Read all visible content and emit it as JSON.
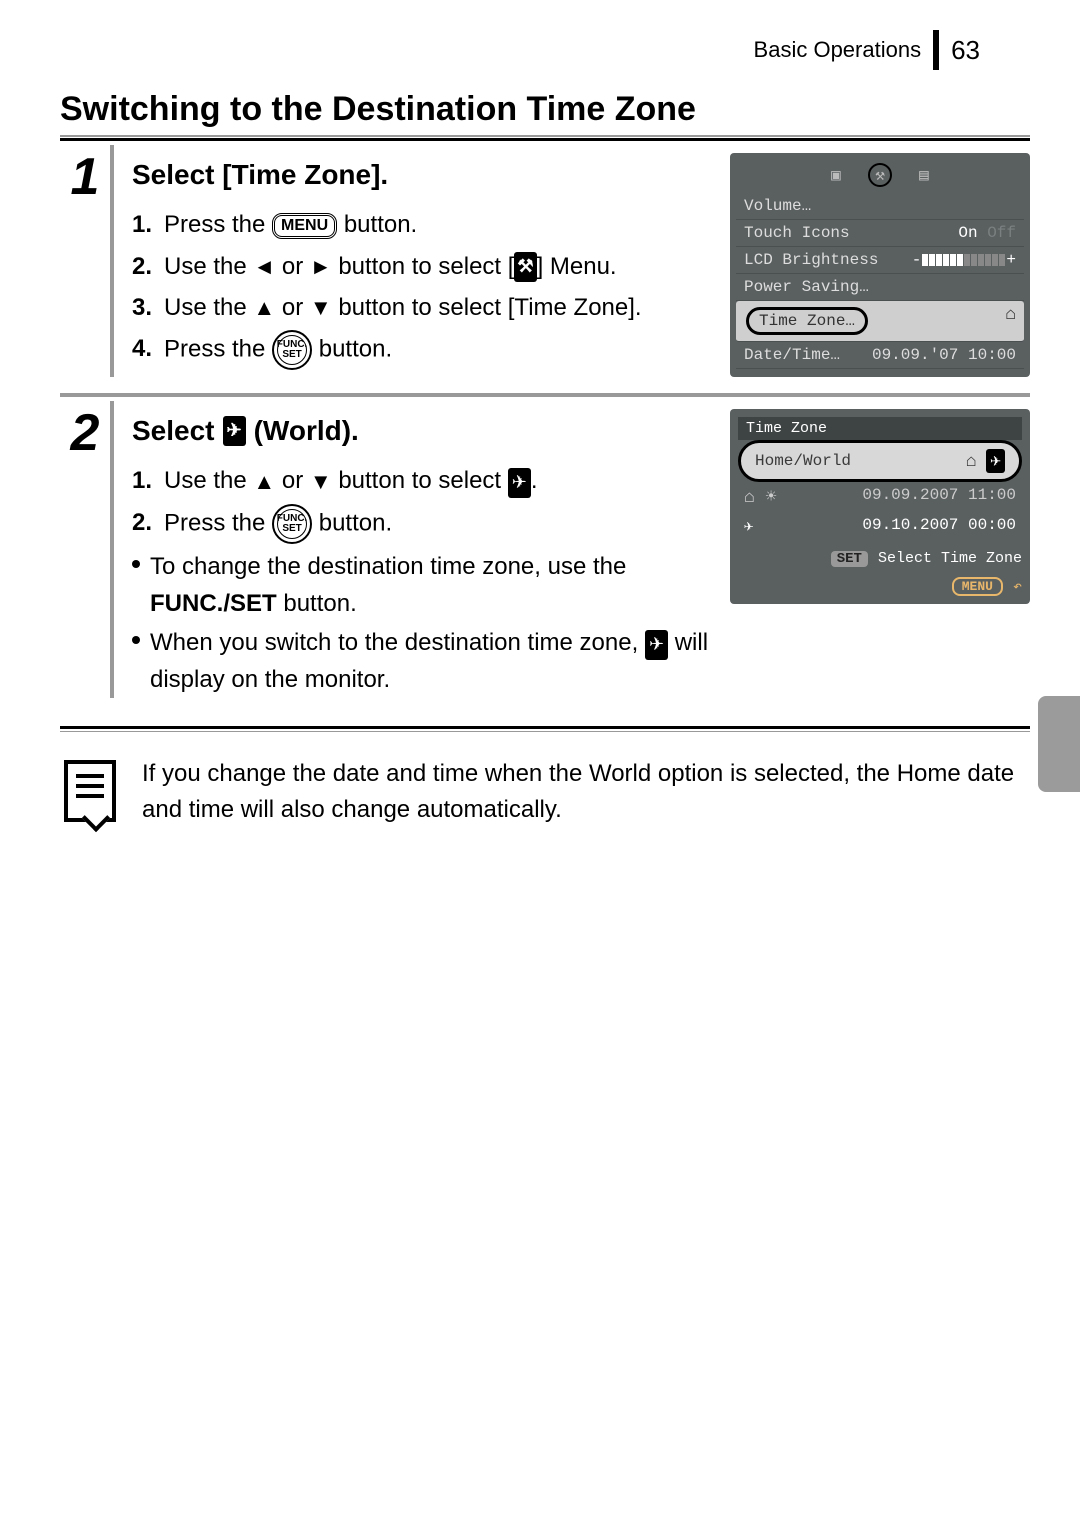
{
  "header": {
    "section": "Basic Operations",
    "page": "63"
  },
  "title": "Switching to the Destination Time Zone",
  "step1": {
    "num": "1",
    "heading": "Select [Time Zone].",
    "s1_num": "1.",
    "s1_a": "Press the ",
    "s1_menu": "MENU",
    "s1_b": " button.",
    "s2_num": "2.",
    "s2_a": "Use the ",
    "s2_b": " or ",
    "s2_c": " button to select [",
    "s2_tool": "⚒",
    "s2_d": "] Menu.",
    "s3_num": "3.",
    "s3_a": "Use the ",
    "s3_b": " or ",
    "s3_c": " button to select [Time Zone].",
    "s4_num": "4.",
    "s4_a": "Press the ",
    "s4_func_top": "FUNC.",
    "s4_func_bot": "SET",
    "s4_b": " button."
  },
  "lcd1": {
    "volume": "Volume…",
    "touch_lbl": "Touch Icons",
    "touch_on": "On",
    "touch_off": "Off",
    "bright": "LCD Brightness",
    "power": "Power Saving…",
    "tz": "Time Zone…",
    "dt_lbl": "Date/Time…",
    "dt_val": "09.09.'07 10:00"
  },
  "step2": {
    "num": "2",
    "heading_a": "Select ",
    "heading_b": " (World).",
    "s1_num": "1.",
    "s1_a": "Use the ",
    "s1_b": " or ",
    "s1_c": " button to select ",
    "s1_d": ".",
    "s2_num": "2.",
    "s2_a": "Press the ",
    "s2_b": " button.",
    "b1_a": "To change the destination time zone, use the ",
    "b1_b": "FUNC./SET",
    "b1_c": " button.",
    "b2_a": "When you switch to the destination time zone, ",
    "b2_b": " will display on the monitor."
  },
  "lcd2": {
    "title": "Time Zone",
    "hw": "Home/World",
    "home_dt": "09.09.2007 11:00",
    "dest_dt": "09.10.2007 00:00",
    "set": "SET",
    "set_txt": "Select Time Zone",
    "menu": "MENU"
  },
  "note": "If you change the date and time when the World option is selected, the Home date and time will also change automatically."
}
